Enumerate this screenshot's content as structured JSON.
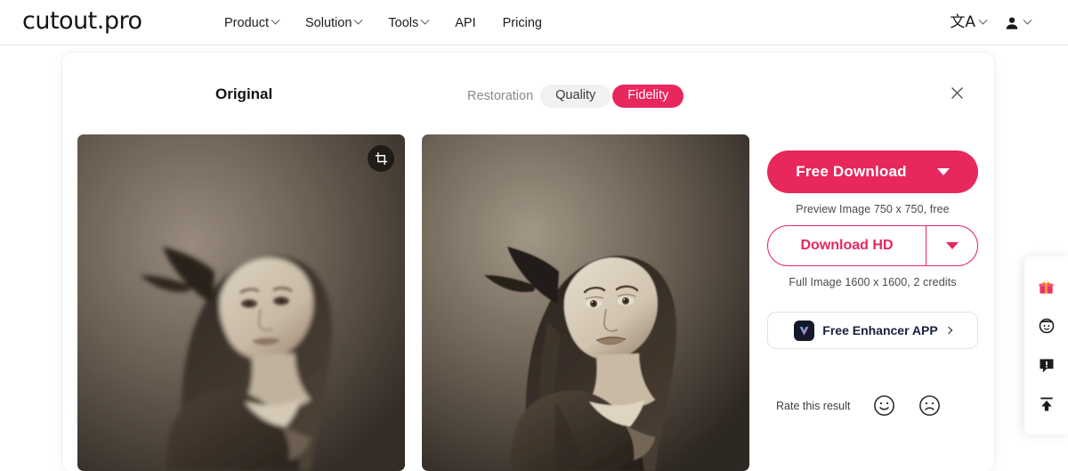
{
  "header": {
    "logo": "cutout.pro",
    "nav": [
      {
        "label": "Product",
        "has_chevron": true
      },
      {
        "label": "Solution",
        "has_chevron": true
      },
      {
        "label": "Tools",
        "has_chevron": true
      },
      {
        "label": "API",
        "has_chevron": false
      },
      {
        "label": "Pricing",
        "has_chevron": false
      }
    ],
    "language_icon": "translate-language-icon",
    "language_glyph": "文A",
    "account_icon": "user-account-icon"
  },
  "card": {
    "title": "Original",
    "mode_label": "Restoration",
    "modes": [
      {
        "label": "Quality",
        "active": false
      },
      {
        "label": "Fidelity",
        "active": true
      }
    ],
    "close_icon": "close-icon",
    "crop_icon": "crop-icon",
    "images": {
      "original_alt": "vintage sepia portrait of a young girl, original",
      "restored_alt": "vintage sepia portrait of a young girl, restored"
    }
  },
  "panel": {
    "free_download_label": "Free Download",
    "free_download_note": "Preview Image 750 x 750, free",
    "download_hd_label": "Download HD",
    "download_hd_note": "Full Image 1600 x 1600, 2 credits",
    "enhancer_app_label": "Free Enhancer APP",
    "enhancer_app_icon": "enhancer-app-icon",
    "rate_label": "Rate this result",
    "rate_positive_icon": "smiley-face-icon",
    "rate_negative_icon": "sad-face-icon",
    "dropdown_icon": "chevron-down-icon"
  },
  "float_bar": {
    "items": [
      {
        "icon": "gift-icon",
        "glyph": "🎁"
      },
      {
        "icon": "face-avatar-icon",
        "glyph": ""
      },
      {
        "icon": "feedback-icon",
        "glyph": ""
      },
      {
        "icon": "scroll-to-top-icon",
        "glyph": ""
      }
    ]
  },
  "colors": {
    "accent": "#e8275c",
    "pill_inactive_bg": "#f1f1f1",
    "text_dark": "#141414",
    "text_muted": "#8a8a8a"
  }
}
